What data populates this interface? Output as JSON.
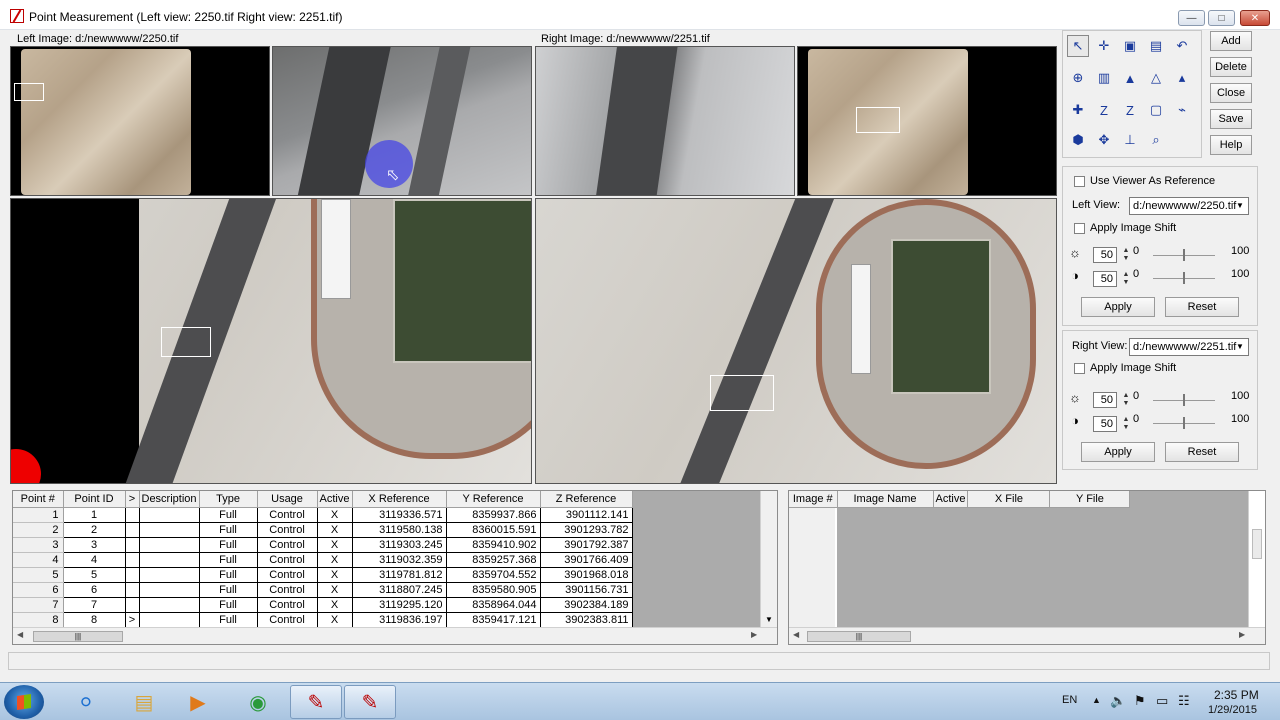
{
  "window": {
    "title": "Point Measurement (Left view: 2250.tif  Right view: 2251.tif)",
    "left_image_label": "Left Image: d:/newwwww/2250.tif",
    "right_image_label": "Right Image: d:/newwwww/2251.tif"
  },
  "side_buttons": {
    "add": "Add",
    "delete": "Delete",
    "close": "Close",
    "save": "Save",
    "help": "Help"
  },
  "tools": [
    {
      "name": "select-arrow-icon",
      "glyph": "↖"
    },
    {
      "name": "crosshair-icon",
      "glyph": "✛"
    },
    {
      "name": "lock-icon",
      "glyph": "▣"
    },
    {
      "name": "box-icon",
      "glyph": "▤"
    },
    {
      "name": "undo-icon",
      "glyph": "↶"
    },
    {
      "name": "zoom-point-icon",
      "glyph": "⊕"
    },
    {
      "name": "window-icon",
      "glyph": "▥"
    },
    {
      "name": "triangle-icon",
      "glyph": "▲"
    },
    {
      "name": "triangle-point-icon",
      "glyph": "△"
    },
    {
      "name": "triangle-edit-icon",
      "glyph": "▴"
    },
    {
      "name": "add-point-icon",
      "glyph": "✚"
    },
    {
      "name": "z-icon",
      "glyph": "Z"
    },
    {
      "name": "z-sub-icon",
      "glyph": "Z"
    },
    {
      "name": "square-icon",
      "glyph": "▢"
    },
    {
      "name": "link-icon",
      "glyph": "⌁"
    },
    {
      "name": "drive-icon",
      "glyph": "⬢"
    },
    {
      "name": "move-point-icon",
      "glyph": "✥"
    },
    {
      "name": "level-icon",
      "glyph": "⊥"
    },
    {
      "name": "magnify-icon",
      "glyph": "⌕"
    }
  ],
  "left_view": {
    "use_viewer_ref": "Use Viewer As Reference",
    "label": "Left View:",
    "file": "d:/newwwww/2250.tif",
    "apply_shift": "Apply Image Shift",
    "brightness": "50",
    "brightness_min": "0",
    "brightness_max": "100",
    "brightness_level": 0.5,
    "contrast": "50",
    "contrast_min": "0",
    "contrast_max": "100",
    "contrast_level": 0.5,
    "apply": "Apply",
    "reset": "Reset"
  },
  "right_view": {
    "label": "Right View:",
    "file": "d:/newwwww/2251.tif",
    "apply_shift": "Apply Image Shift",
    "brightness": "50",
    "brightness_min": "0",
    "brightness_max": "100",
    "brightness_level": 0.5,
    "contrast": "50",
    "contrast_min": "0",
    "contrast_max": "100",
    "contrast_level": 0.5,
    "apply": "Apply",
    "reset": "Reset"
  },
  "points_table": {
    "headers": [
      "Point #",
      "Point ID",
      ">",
      "Description",
      "Type",
      "Usage",
      "Active",
      "X Reference",
      "Y Reference",
      "Z Reference"
    ],
    "rows": [
      [
        "1",
        "1",
        "",
        "",
        "Full",
        "Control",
        "X",
        "3119336.571",
        "8359937.866",
        "3901112.141"
      ],
      [
        "2",
        "2",
        "",
        "",
        "Full",
        "Control",
        "X",
        "3119580.138",
        "8360015.591",
        "3901293.782"
      ],
      [
        "3",
        "3",
        "",
        "",
        "Full",
        "Control",
        "X",
        "3119303.245",
        "8359410.902",
        "3901792.387"
      ],
      [
        "4",
        "4",
        "",
        "",
        "Full",
        "Control",
        "X",
        "3119032.359",
        "8359257.368",
        "3901766.409"
      ],
      [
        "5",
        "5",
        "",
        "",
        "Full",
        "Control",
        "X",
        "3119781.812",
        "8359704.552",
        "3901968.018"
      ],
      [
        "6",
        "6",
        "",
        "",
        "Full",
        "Control",
        "X",
        "3118807.245",
        "8359580.905",
        "3901156.731"
      ],
      [
        "7",
        "7",
        "",
        "",
        "Full",
        "Control",
        "X",
        "3119295.120",
        "8358964.044",
        "3902384.189"
      ],
      [
        "8",
        "8",
        ">",
        "",
        "Full",
        "Control",
        "X",
        "3119836.197",
        "8359417.121",
        "3902383.811"
      ]
    ]
  },
  "image_table": {
    "headers": [
      "Image #",
      "Image Name",
      "Active",
      "X File",
      "Y File"
    ]
  },
  "taskbar": {
    "lang": "EN",
    "time": "2:35 PM",
    "date": "1/29/2015"
  }
}
